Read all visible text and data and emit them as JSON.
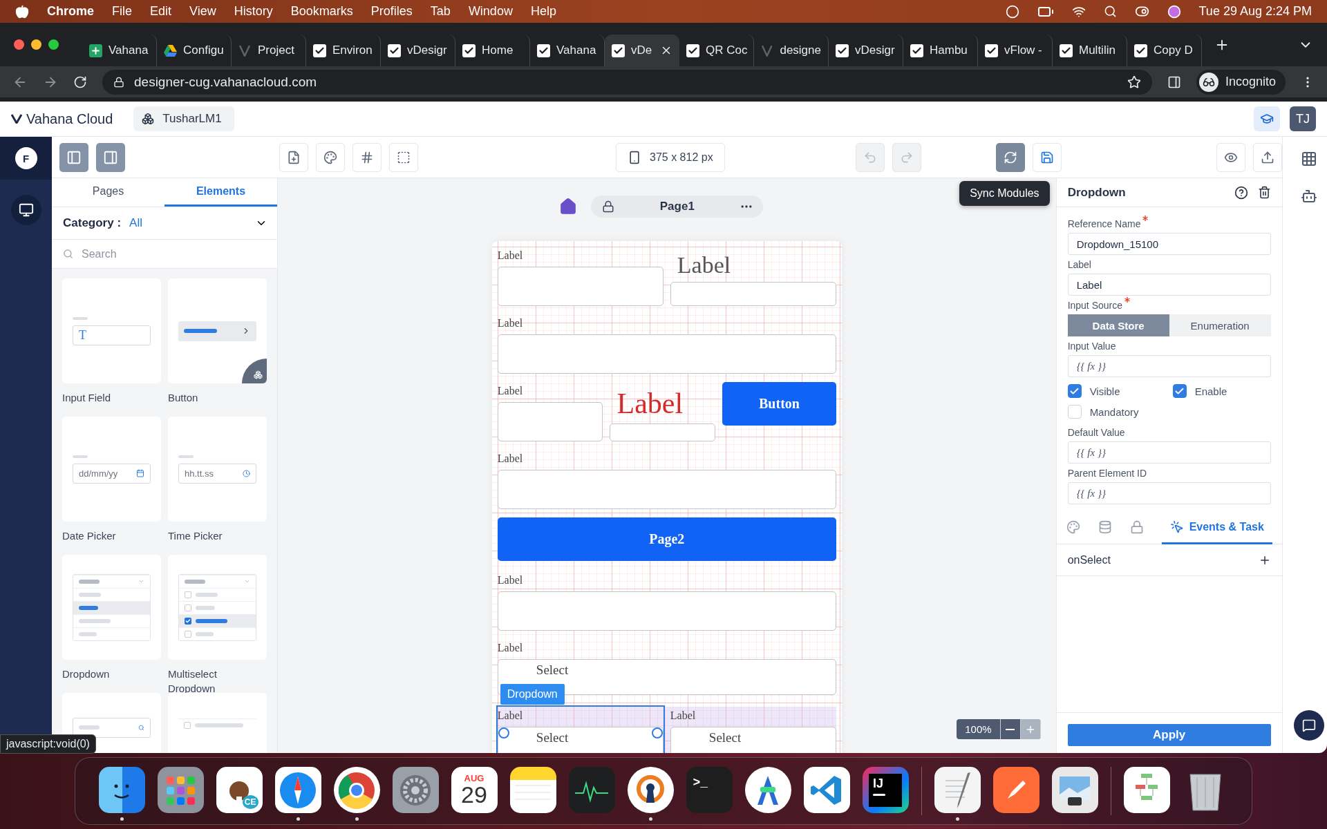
{
  "menu_bar": {
    "app": "Chrome",
    "items": [
      "File",
      "Edit",
      "View",
      "History",
      "Bookmarks",
      "Profiles",
      "Tab",
      "Window",
      "Help"
    ],
    "clock": "Tue 29 Aug  2:24 PM"
  },
  "browser": {
    "tabs": [
      {
        "label": "Vahana",
        "kind": "sheet",
        "selected": false
      },
      {
        "label": "Configu",
        "kind": "drive",
        "selected": false
      },
      {
        "label": "Project",
        "kind": "faded",
        "selected": false
      },
      {
        "label": "Environ",
        "kind": "check",
        "selected": false
      },
      {
        "label": "vDesigr",
        "kind": "check",
        "selected": false
      },
      {
        "label": "Home",
        "kind": "check",
        "selected": false
      },
      {
        "label": "Vahana",
        "kind": "check",
        "selected": false
      },
      {
        "label": "vDe",
        "kind": "check",
        "selected": true
      },
      {
        "label": "QR Coc",
        "kind": "check",
        "selected": false
      },
      {
        "label": "designe",
        "kind": "faded",
        "selected": false
      },
      {
        "label": "vDesigr",
        "kind": "check",
        "selected": false
      },
      {
        "label": "Hambu",
        "kind": "check",
        "selected": false
      },
      {
        "label": "vFlow -",
        "kind": "check",
        "selected": false
      },
      {
        "label": "Multilin",
        "kind": "check",
        "selected": false
      },
      {
        "label": "Copy D",
        "kind": "check",
        "selected": false
      }
    ],
    "url": "designer-cug.vahanacloud.com",
    "profile": "Incognito"
  },
  "app_header": {
    "brand": "Vahana Cloud",
    "workspace": "TusharLM1",
    "user_initials": "TJ"
  },
  "sidebar": {
    "avatar": "F"
  },
  "left_panel": {
    "tabs": [
      {
        "label": "Pages",
        "selected": false
      },
      {
        "label": "Elements",
        "selected": true
      }
    ],
    "category_label": "Category :",
    "category_value": "All",
    "search_placeholder": "Search",
    "elements": [
      {
        "kind": "input",
        "label": "Input Field",
        "preview": "T"
      },
      {
        "kind": "button",
        "label": "Button"
      },
      {
        "kind": "date",
        "label": "Date Picker",
        "preview": "dd/mm/yy"
      },
      {
        "kind": "time",
        "label": "Time Picker",
        "preview": "hh.tt.ss"
      },
      {
        "kind": "dropdown",
        "label": "Dropdown"
      },
      {
        "kind": "multiselect",
        "label": "Multiselect Dropdown"
      },
      {
        "kind": "search"
      },
      {
        "kind": "checkbox"
      }
    ]
  },
  "toolbar": {
    "device_size": "375 x 812 px",
    "tooltip": "Sync Modules"
  },
  "page_bar": {
    "page": "Page1"
  },
  "phone": {
    "rows": [
      {
        "items": [
          {
            "kind": "field",
            "label": "Label"
          },
          {
            "kind": "large_field",
            "label": "Label"
          }
        ]
      },
      {
        "items": [
          {
            "kind": "field",
            "label": "Label"
          }
        ]
      },
      {
        "items": [
          {
            "kind": "field",
            "label": "Label"
          },
          {
            "kind": "red_field",
            "label": "Label"
          },
          {
            "kind": "button",
            "text": "Button"
          }
        ]
      },
      {
        "items": [
          {
            "kind": "field",
            "label": "Label"
          }
        ]
      },
      {
        "items": [
          {
            "kind": "button",
            "text": "Page2"
          }
        ]
      },
      {
        "items": [
          {
            "kind": "field",
            "label": "Label"
          }
        ]
      },
      {
        "items": [
          {
            "kind": "select",
            "label": "Label",
            "value": "Select",
            "selected": false
          }
        ]
      },
      {
        "items": [
          {
            "kind": "select",
            "label": "Label",
            "value": "Select",
            "selected": true,
            "badge": "Dropdown"
          },
          {
            "kind": "select",
            "label": "Label",
            "value": "Select",
            "selected": false
          }
        ]
      }
    ]
  },
  "zoom": {
    "value": "100%",
    "plus_disabled": true
  },
  "properties": {
    "title": "Dropdown",
    "fields": [
      {
        "kind": "text",
        "label": "Reference Name",
        "required": true,
        "value": "Dropdown_15100"
      },
      {
        "kind": "text",
        "label": "Label",
        "required": false,
        "value": "Label"
      },
      {
        "kind": "segmented",
        "label": "Input Source",
        "required": true,
        "options": [
          {
            "label": "Data Store",
            "selected": true
          },
          {
            "label": "Enumeration",
            "selected": false
          }
        ]
      },
      {
        "kind": "formula",
        "label": "Input Value",
        "required": false,
        "placeholder": "{{ fx }}"
      },
      {
        "kind": "checks",
        "checkboxes": [
          {
            "label": "Visible",
            "checked": true
          },
          {
            "label": "Enable",
            "checked": true
          },
          {
            "label": "Mandatory",
            "checked": false
          }
        ]
      },
      {
        "kind": "formula",
        "label": "Default Value",
        "required": false,
        "placeholder": "{{ fx }}"
      },
      {
        "kind": "formula",
        "label": "Parent Element ID",
        "required": false,
        "placeholder": "{{ fx }}"
      }
    ],
    "tabs": [
      {
        "kind": "style",
        "selected": false
      },
      {
        "kind": "data",
        "selected": false
      },
      {
        "kind": "security",
        "selected": false
      },
      {
        "kind": "events",
        "label": "Events & Task",
        "selected": true
      }
    ],
    "events": [
      {
        "name": "onSelect"
      }
    ],
    "apply": "Apply"
  },
  "status_url": "javascript:void(0)",
  "dock": [
    {
      "kind": "finder",
      "running": true
    },
    {
      "kind": "launchpad",
      "running": false
    },
    {
      "kind": "beaver",
      "label": "CE",
      "running": false
    },
    {
      "kind": "compass",
      "running": true
    },
    {
      "kind": "chrome",
      "running": true
    },
    {
      "kind": "settings",
      "running": false
    },
    {
      "kind": "calendar",
      "month": "AUG",
      "day": "29",
      "running": false
    },
    {
      "kind": "notes",
      "running": false
    },
    {
      "kind": "activity",
      "running": false
    },
    {
      "kind": "vpn",
      "running": true
    },
    {
      "kind": "terminal",
      "label": ">_",
      "running": false
    },
    {
      "kind": "android",
      "running": false
    },
    {
      "kind": "vscode",
      "running": false
    },
    {
      "kind": "intellij",
      "label": "IJ",
      "running": false
    },
    {
      "kind": "divider"
    },
    {
      "kind": "textedit",
      "running": true
    },
    {
      "kind": "postman",
      "running": false
    },
    {
      "kind": "preview",
      "running": false
    },
    {
      "kind": "divider"
    },
    {
      "kind": "document",
      "running": false
    },
    {
      "kind": "trash",
      "running": false
    }
  ]
}
